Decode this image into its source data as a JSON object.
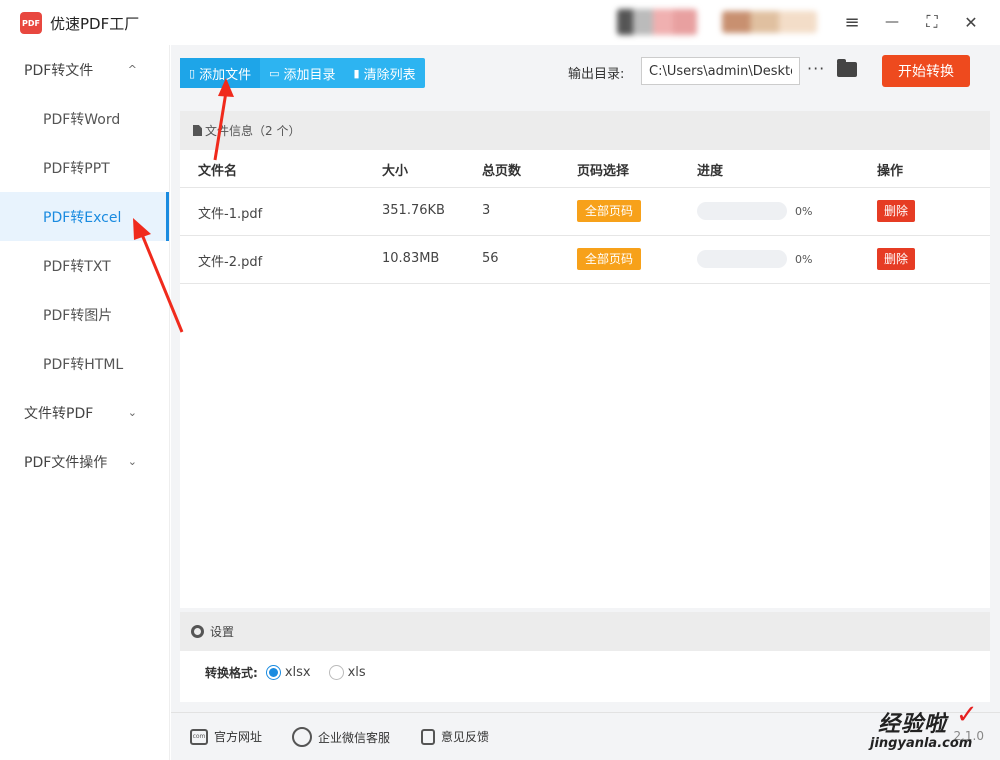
{
  "app": {
    "title": "优速PDF工厂",
    "logo_text": "PDF"
  },
  "window_controls": {
    "menu": "≡",
    "minimize": "—",
    "maximize": "⛶",
    "close": "✕"
  },
  "sidebar": {
    "groups": [
      {
        "label": "PDF转文件",
        "expanded": true,
        "chevron": "^",
        "items": [
          {
            "label": "PDF转Word",
            "active": false
          },
          {
            "label": "PDF转PPT",
            "active": false
          },
          {
            "label": "PDF转Excel",
            "active": true
          },
          {
            "label": "PDF转TXT",
            "active": false
          },
          {
            "label": "PDF转图片",
            "active": false
          },
          {
            "label": "PDF转HTML",
            "active": false
          }
        ]
      },
      {
        "label": "文件转PDF",
        "expanded": false,
        "chevron": "⌄"
      },
      {
        "label": "PDF文件操作",
        "expanded": false,
        "chevron": "⌄"
      }
    ]
  },
  "toolbar": {
    "add_file": "添加文件",
    "add_folder": "添加目录",
    "clear_list": "清除列表"
  },
  "output": {
    "label": "输出目录:",
    "path": "C:\\Users\\admin\\Deskto",
    "more": "···",
    "start_button": "开始转换"
  },
  "file_panel": {
    "header": "文件信息（2 个）",
    "columns": [
      "文件名",
      "大小",
      "总页数",
      "页码选择",
      "进度",
      "操作"
    ],
    "rows": [
      {
        "name": "文件-1.pdf",
        "size": "351.76KB",
        "pages": "3",
        "range": "全部页码",
        "progress": 0,
        "progress_text": "0%",
        "action": "删除"
      },
      {
        "name": "文件-2.pdf",
        "size": "10.83MB",
        "pages": "56",
        "range": "全部页码",
        "progress": 0,
        "progress_text": "0%",
        "action": "删除"
      }
    ]
  },
  "settings": {
    "header": "设置",
    "format_label": "转换格式:",
    "options": [
      {
        "label": "xlsx",
        "selected": true
      },
      {
        "label": "xls",
        "selected": false
      }
    ]
  },
  "footer": {
    "website": "官方网址",
    "wechat": "企业微信客服",
    "feedback": "意见反馈",
    "version": "2.1.0"
  },
  "watermark": {
    "title": "经验啦",
    "check": "✓",
    "url": "jingyanla.com"
  },
  "colors": {
    "accent": "#2db4f1",
    "primary_blue": "#1a8be0",
    "start_button": "#ee4a1e",
    "badge_orange": "#f7a11a",
    "delete_red": "#e63c24",
    "annotation_arrow": "#f02a1c"
  }
}
